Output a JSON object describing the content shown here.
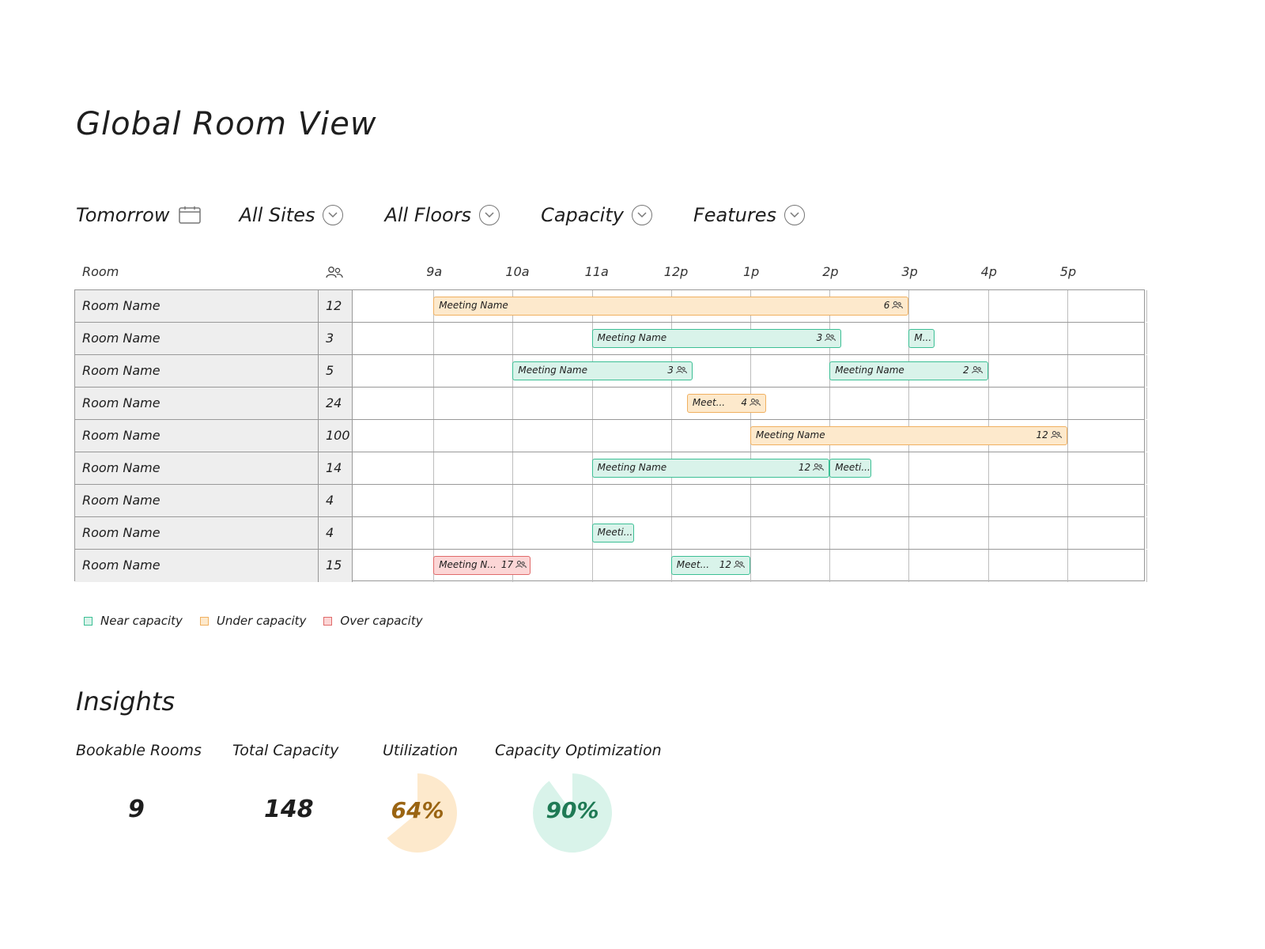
{
  "page": {
    "title": "Global Room View"
  },
  "filters": {
    "date": "Tomorrow",
    "sites": "All Sites",
    "floors": "All Floors",
    "capacity": "Capacity",
    "features": "Features"
  },
  "schedule": {
    "room_header": "Room",
    "capacity_header_icon": "people-icon",
    "hours": [
      "9a",
      "10a",
      "11a",
      "12p",
      "1p",
      "2p",
      "3p",
      "4p",
      "5p"
    ],
    "rooms": [
      {
        "name": "Room Name",
        "capacity": "12",
        "events": [
          {
            "label": "Meeting Name",
            "count": "6",
            "status": "under",
            "start": 9.0,
            "end": 15.0
          }
        ]
      },
      {
        "name": "Room Name",
        "capacity": "3",
        "events": [
          {
            "label": "Meeting Name",
            "count": "3",
            "status": "near",
            "start": 11.0,
            "end": 14.15
          },
          {
            "label": "M...",
            "count": "",
            "status": "near",
            "start": 15.0,
            "end": 15.33
          }
        ]
      },
      {
        "name": "Room Name",
        "capacity": "5",
        "events": [
          {
            "label": "Meeting Name",
            "count": "3",
            "status": "near",
            "start": 10.0,
            "end": 12.27
          },
          {
            "label": "Meeting Name",
            "count": "2",
            "status": "near",
            "start": 14.0,
            "end": 16.0
          }
        ]
      },
      {
        "name": "Room Name",
        "capacity": "24",
        "events": [
          {
            "label": "Meet...",
            "count": "4",
            "status": "under",
            "start": 12.2,
            "end": 13.2
          }
        ]
      },
      {
        "name": "Room Name",
        "capacity": "100",
        "events": [
          {
            "label": "Meeting Name",
            "count": "12",
            "status": "under",
            "start": 13.0,
            "end": 17.0
          }
        ]
      },
      {
        "name": "Room Name",
        "capacity": "14",
        "events": [
          {
            "label": "Meeting Name",
            "count": "12",
            "status": "near",
            "start": 11.0,
            "end": 14.0
          },
          {
            "label": "Meeti...",
            "count": "",
            "status": "near",
            "start": 14.0,
            "end": 14.53
          }
        ]
      },
      {
        "name": "Room Name",
        "capacity": "4",
        "events": []
      },
      {
        "name": "Room Name",
        "capacity": "4",
        "events": [
          {
            "label": "Meeti...",
            "count": "",
            "status": "near",
            "start": 11.0,
            "end": 11.53
          }
        ]
      },
      {
        "name": "Room Name",
        "capacity": "15",
        "events": [
          {
            "label": "Meeting N...",
            "count": "17",
            "status": "over",
            "start": 9.0,
            "end": 10.23
          },
          {
            "label": "Meet...",
            "count": "12",
            "status": "near",
            "start": 12.0,
            "end": 13.0
          }
        ]
      }
    ]
  },
  "legend": {
    "near": "Near capacity",
    "under": "Under capacity",
    "over": "Over capacity"
  },
  "colors": {
    "near_fill": "#d9f3ea",
    "near_border": "#3cbf95",
    "under_fill": "#fde9cc",
    "under_border": "#f0b060",
    "over_fill": "#fcd6d6",
    "over_border": "#e06a6a",
    "utilization_text": "#9a6412",
    "optimization_text": "#1f7a55"
  },
  "insights": {
    "title": "Insights",
    "bookable_rooms": {
      "label": "Bookable Rooms",
      "value": "9"
    },
    "total_capacity": {
      "label": "Total Capacity",
      "value": "148"
    },
    "utilization": {
      "label": "Utilization",
      "value": "64%",
      "fraction": 0.64
    },
    "capacity_optimization": {
      "label": "Capacity Optimization",
      "value": "90%",
      "fraction": 0.9
    }
  }
}
